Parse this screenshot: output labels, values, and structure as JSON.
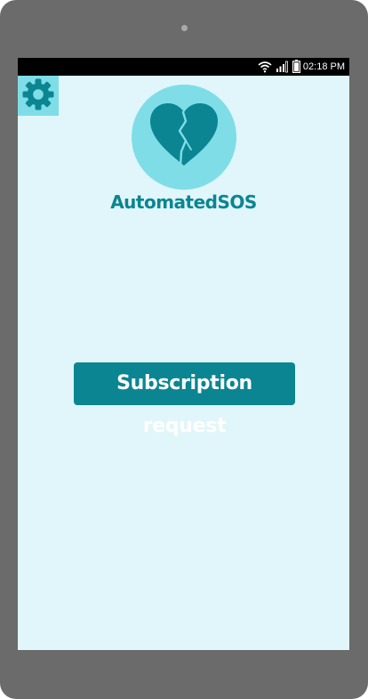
{
  "status_bar": {
    "time": "02:18 PM",
    "icons": [
      "wifi-icon",
      "signal-icon",
      "battery-icon"
    ]
  },
  "toolbar": {
    "settings_icon": "gear-icon"
  },
  "logo": {
    "icon": "broken-heart-icon"
  },
  "app": {
    "name": "AutomatedSOS"
  },
  "main": {
    "subscription_button_label": "Subscription request"
  },
  "colors": {
    "accent": "#0b8591",
    "accent_light": "#7fdde8",
    "background": "#e0f6fa",
    "device_frame": "#6b6b6b"
  }
}
